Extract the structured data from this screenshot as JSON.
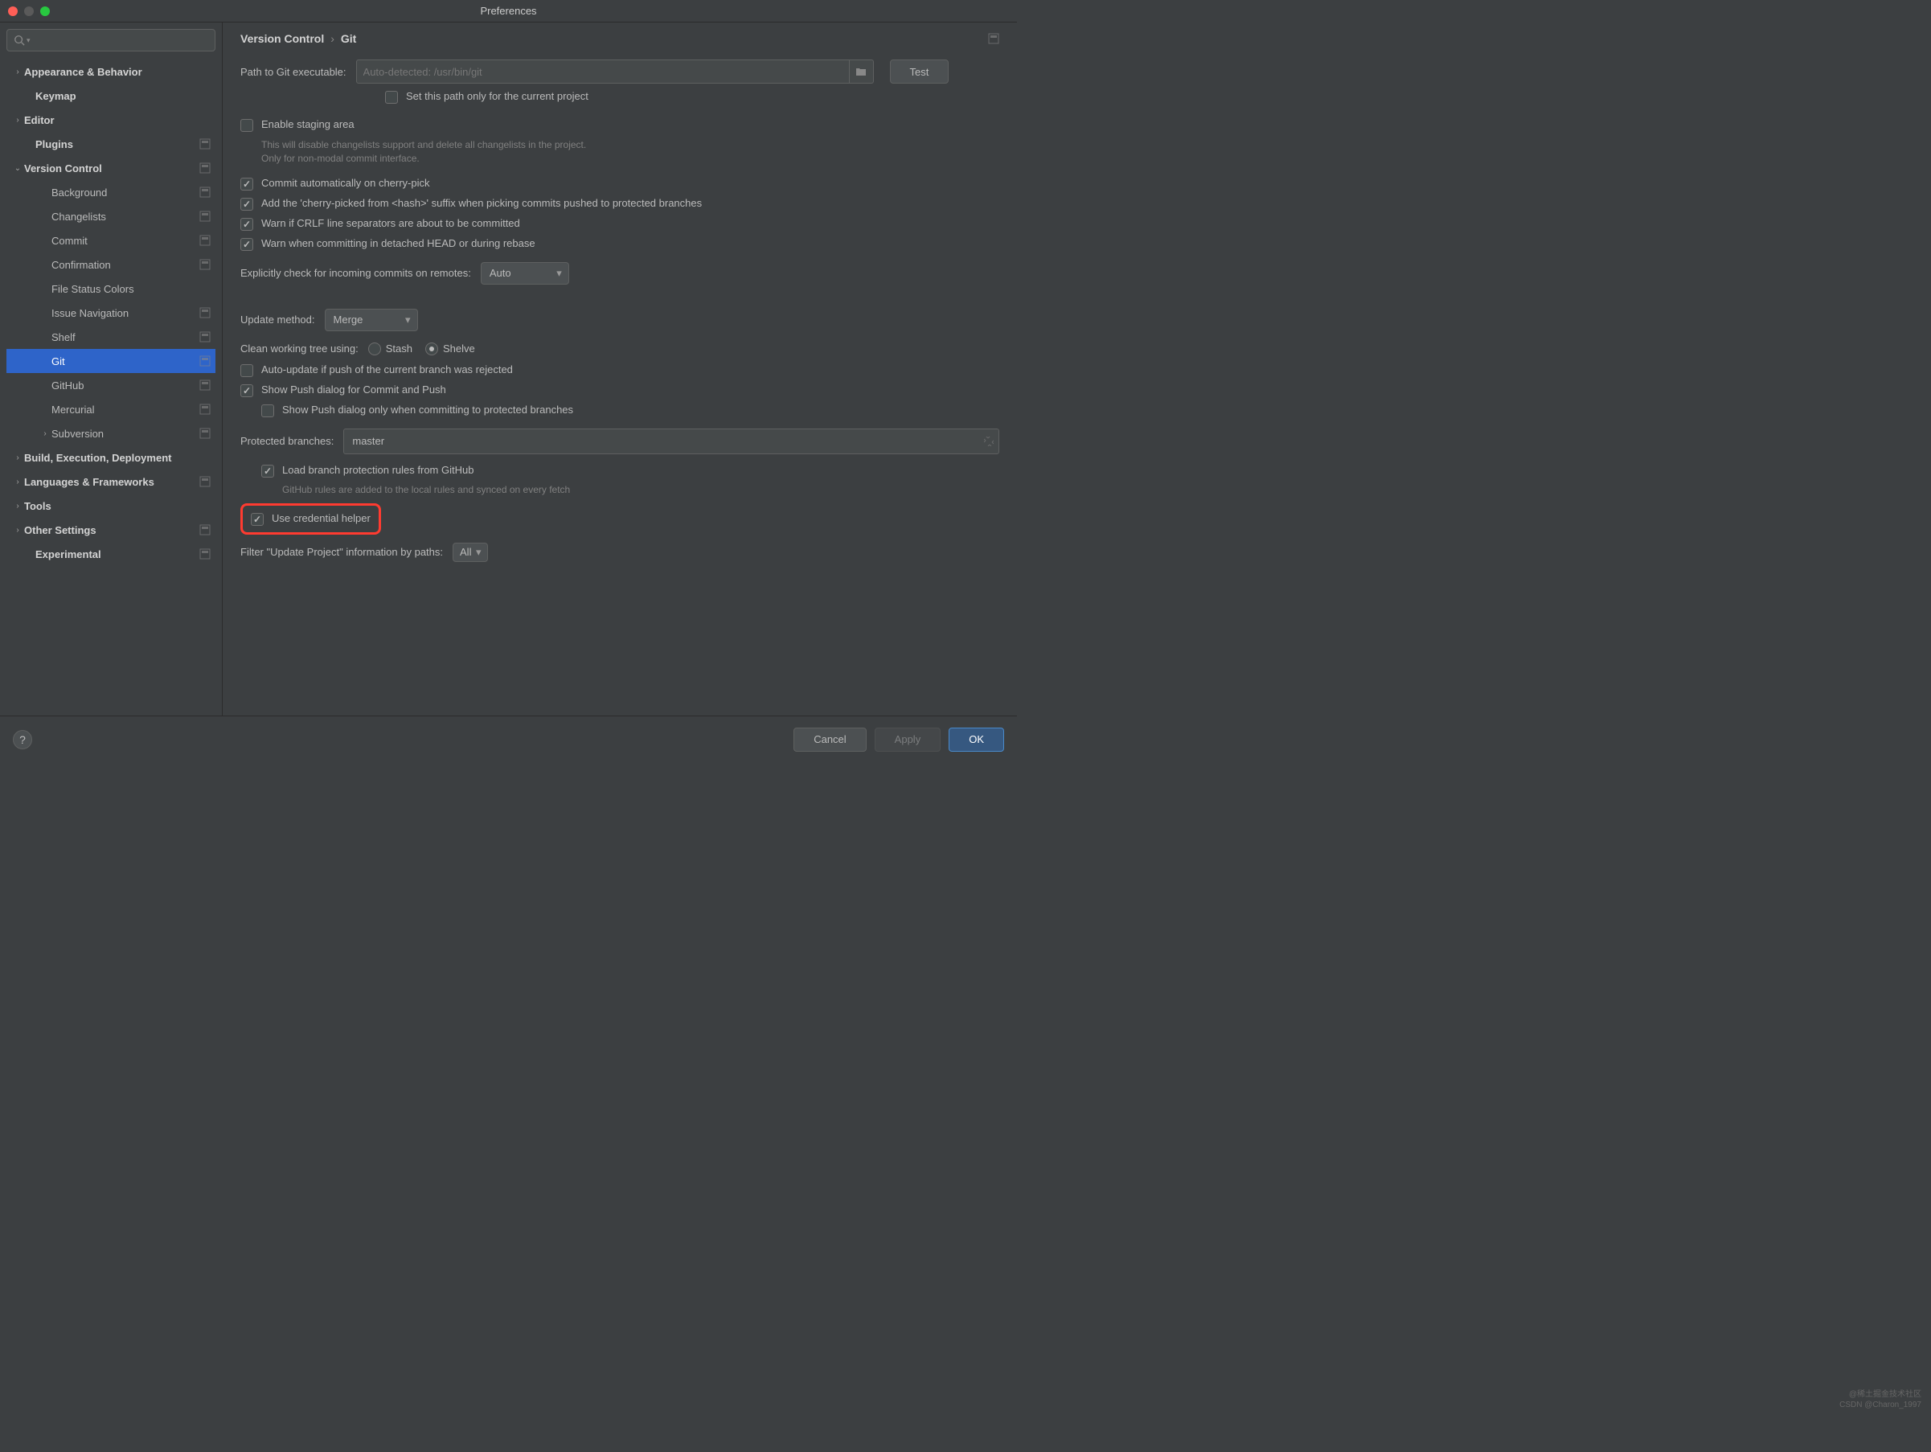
{
  "title": "Preferences",
  "breadcrumb": {
    "parent": "Version Control",
    "current": "Git"
  },
  "sidebar": {
    "items": [
      {
        "label": "Appearance & Behavior",
        "arrow": "›",
        "bold": true
      },
      {
        "label": "Keymap",
        "bold": true,
        "indent": 1
      },
      {
        "label": "Editor",
        "arrow": "›",
        "bold": true
      },
      {
        "label": "Plugins",
        "bold": true,
        "indent": 1,
        "proj": true
      },
      {
        "label": "Version Control",
        "arrow": "⌄",
        "bold": true,
        "proj": true
      },
      {
        "label": "Background",
        "indent": 2,
        "proj": true
      },
      {
        "label": "Changelists",
        "indent": 2,
        "proj": true
      },
      {
        "label": "Commit",
        "indent": 2,
        "proj": true
      },
      {
        "label": "Confirmation",
        "indent": 2,
        "proj": true
      },
      {
        "label": "File Status Colors",
        "indent": 2
      },
      {
        "label": "Issue Navigation",
        "indent": 2,
        "proj": true
      },
      {
        "label": "Shelf",
        "indent": 2,
        "proj": true
      },
      {
        "label": "Git",
        "indent": 2,
        "proj": true,
        "selected": true
      },
      {
        "label": "GitHub",
        "indent": 2,
        "proj": true
      },
      {
        "label": "Mercurial",
        "indent": 2,
        "proj": true
      },
      {
        "label": "Subversion",
        "arrow": "›",
        "indent": 2,
        "proj": true
      },
      {
        "label": "Build, Execution, Deployment",
        "arrow": "›",
        "bold": true
      },
      {
        "label": "Languages & Frameworks",
        "arrow": "›",
        "bold": true,
        "proj": true
      },
      {
        "label": "Tools",
        "arrow": "›",
        "bold": true
      },
      {
        "label": "Other Settings",
        "arrow": "›",
        "bold": true,
        "proj": true
      },
      {
        "label": "Experimental",
        "bold": true,
        "indent": 1,
        "proj": true
      }
    ]
  },
  "git": {
    "pathLabel": "Path to Git executable:",
    "pathPlaceholder": "Auto-detected: /usr/bin/git",
    "testLabel": "Test",
    "setPathProject": {
      "label": "Set this path only for the current project",
      "checked": false
    },
    "enableStaging": {
      "label": "Enable staging area",
      "checked": false,
      "hint": "This will disable changelists support and delete all changelists in the project. Only for non-modal commit interface."
    },
    "commitCherryPick": {
      "label": "Commit automatically on cherry-pick",
      "checked": true
    },
    "addSuffix": {
      "label": "Add the 'cherry-picked from <hash>' suffix when picking commits pushed to protected branches",
      "checked": true
    },
    "warnCrlf": {
      "label": "Warn if CRLF line separators are about to be committed",
      "checked": true
    },
    "warnDetached": {
      "label": "Warn when committing in detached HEAD or during rebase",
      "checked": true
    },
    "explicitCheckLabel": "Explicitly check for incoming commits on remotes:",
    "explicitCheckValue": "Auto",
    "updateMethodLabel": "Update method:",
    "updateMethodValue": "Merge",
    "cleanTreeLabel": "Clean working tree using:",
    "stashLabel": "Stash",
    "shelveLabel": "Shelve",
    "shelveSelected": true,
    "autoUpdate": {
      "label": "Auto-update if push of the current branch was rejected",
      "checked": false
    },
    "showPushDialog": {
      "label": "Show Push dialog for Commit and Push",
      "checked": true
    },
    "showPushProtected": {
      "label": "Show Push dialog only when committing to protected branches",
      "checked": false
    },
    "protectedLabel": "Protected branches:",
    "protectedValue": "master",
    "loadBranchRules": {
      "label": "Load branch protection rules from GitHub",
      "checked": true,
      "hint": "GitHub rules are added to the local rules and synced on every fetch"
    },
    "useCredential": {
      "label": "Use credential helper",
      "checked": true
    },
    "filterLabel": "Filter \"Update Project\" information by paths:",
    "filterValue": "All"
  },
  "footer": {
    "cancel": "Cancel",
    "apply": "Apply",
    "ok": "OK"
  },
  "watermark": {
    "line1": "@稀土掘金技术社区",
    "line2": "CSDN @Charon_1997"
  }
}
